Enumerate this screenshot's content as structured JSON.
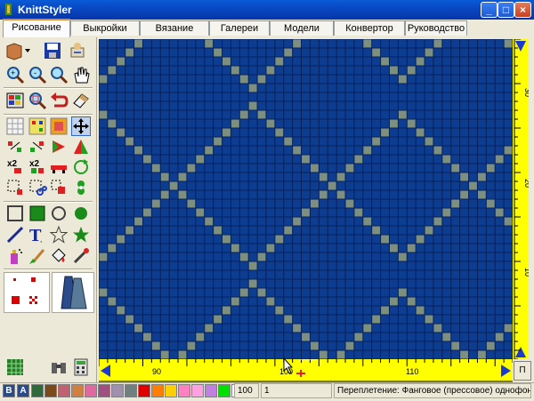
{
  "window": {
    "title": "KnittStyler"
  },
  "tabs": [
    {
      "label": "Рисование",
      "active": true
    },
    {
      "label": "Выкройки",
      "active": false
    },
    {
      "label": "Вязание",
      "active": false
    },
    {
      "label": "Галереи",
      "active": false
    },
    {
      "label": "Модели",
      "active": false
    },
    {
      "label": "Конвертор",
      "active": false
    },
    {
      "label": "Руководство",
      "active": false
    }
  ],
  "grid": {
    "cols": 47,
    "rows": 36,
    "bg_color": "#0d3d91",
    "stitch_color": "#7d8f7e",
    "line_color": "#08215a"
  },
  "ruler_v": {
    "labels": [
      "30",
      "20",
      "10"
    ]
  },
  "ruler_h": {
    "labels": [
      "90",
      "100",
      "110"
    ],
    "corner_button": "П"
  },
  "status": {
    "letters": [
      "B",
      "A"
    ],
    "swatches": [
      "#2f6a3a",
      "#7a4a1a",
      "#c06070",
      "#d08040",
      "#e06aa0",
      "#a05080",
      "#a090b0",
      "#708080",
      "#e00000",
      "#ff8000",
      "#ffd000",
      "#ff80c0",
      "#ffa0e0",
      "#c080e0",
      "#00e000",
      "#ffffff"
    ],
    "zoom": "100",
    "value": "1",
    "text": "Переплетение: Фанговое (прессовое) однофонтурное"
  },
  "colors": {
    "accent_yellow": "#ffff00",
    "titlebar": "#0848c4"
  }
}
